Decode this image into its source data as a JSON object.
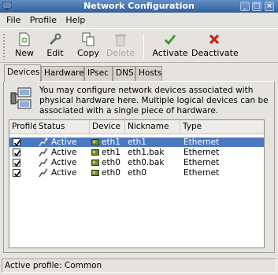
{
  "window": {
    "title": "Network Configuration"
  },
  "menubar": {
    "file": "File",
    "profile": "Profile",
    "help": "Help"
  },
  "toolbar": {
    "new": "New",
    "edit": "Edit",
    "copy": "Copy",
    "delete": "Delete",
    "activate": "Activate",
    "deactivate": "Deactivate"
  },
  "tabs": {
    "devices": "Devices",
    "hardware": "Hardware",
    "ipsec": "IPsec",
    "dns": "DNS",
    "hosts": "Hosts"
  },
  "info": {
    "line1": "You may configure network devices associated with",
    "line2": "physical hardware here.  Multiple logical devices can be",
    "line3": "associated with a single piece of hardware."
  },
  "table": {
    "headers": {
      "profile": "Profile",
      "status": "Status",
      "device": "Device",
      "nickname": "Nickname",
      "type": "Type"
    },
    "rows": [
      {
        "profile_checked": true,
        "status": "Active",
        "device": "eth1",
        "nickname": "eth1",
        "type": "Ethernet",
        "selected": true
      },
      {
        "profile_checked": true,
        "status": "Active",
        "device": "eth1",
        "nickname": "eth1.bak",
        "type": "Ethernet",
        "selected": false
      },
      {
        "profile_checked": true,
        "status": "Active",
        "device": "eth0",
        "nickname": "eth0.bak",
        "type": "Ethernet",
        "selected": false
      },
      {
        "profile_checked": true,
        "status": "Active",
        "device": "eth0",
        "nickname": "eth0",
        "type": "Ethernet",
        "selected": false
      }
    ]
  },
  "statusbar": {
    "text": "Active profile: Common"
  },
  "colors": {
    "titlebar": "#4a78b2",
    "selection": "#4b79c0",
    "window_bg": "#e5e3df"
  }
}
